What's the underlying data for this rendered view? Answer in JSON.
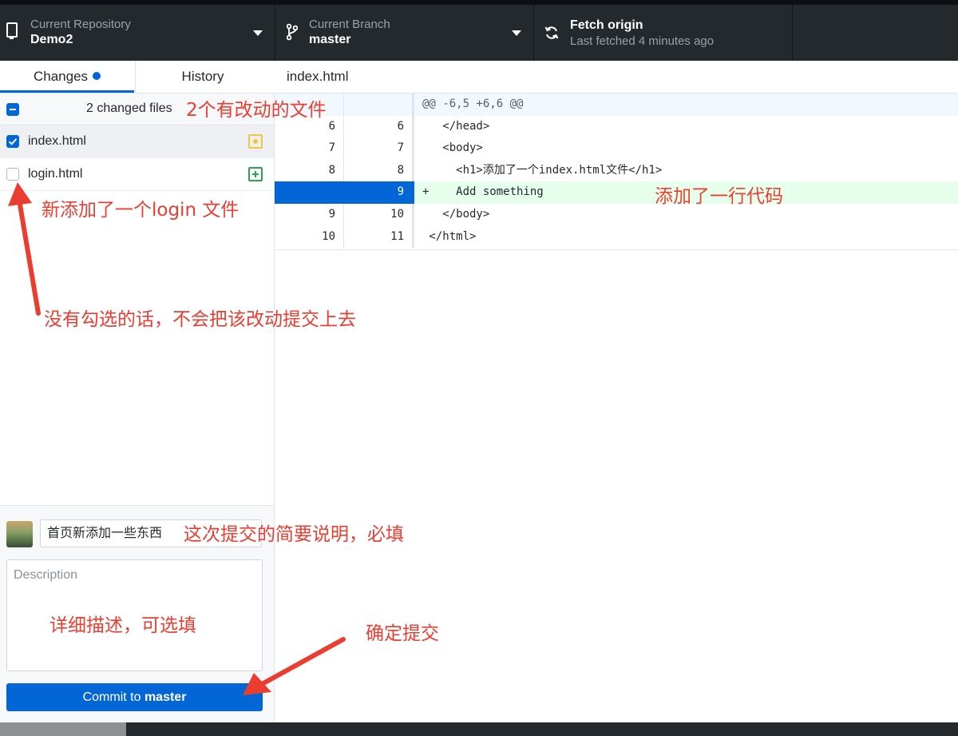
{
  "toolbar": {
    "repo_label": "Current Repository",
    "repo_name": "Demo2",
    "branch_label": "Current Branch",
    "branch_name": "master",
    "fetch_title": "Fetch origin",
    "fetch_subtitle": "Last fetched 4 minutes ago"
  },
  "tabs": {
    "changes": "Changes",
    "history": "History"
  },
  "changes": {
    "header": "2 changed files",
    "files": [
      {
        "name": "index.html",
        "checked": true,
        "status": "modified"
      },
      {
        "name": "login.html",
        "checked": false,
        "status": "added"
      }
    ]
  },
  "commit": {
    "summary": "首页新添加一些东西",
    "description_placeholder": "Description",
    "button_prefix": "Commit to",
    "button_branch": "master"
  },
  "diff": {
    "filename": "index.html",
    "rows": [
      {
        "old": "",
        "new": "",
        "text": "@@ -6,5 +6,6 @@",
        "kind": "hunk"
      },
      {
        "old": "6",
        "new": "6",
        "text": "   </head>",
        "kind": "ctx"
      },
      {
        "old": "7",
        "new": "7",
        "text": "   <body>",
        "kind": "ctx"
      },
      {
        "old": "8",
        "new": "8",
        "text": "     <h1>添加了一个index.html文件</h1>",
        "kind": "ctx"
      },
      {
        "old": "",
        "new": "9",
        "text": "+    Add something",
        "kind": "add"
      },
      {
        "old": "9",
        "new": "10",
        "text": "   </body>",
        "kind": "ctx"
      },
      {
        "old": "10",
        "new": "11",
        "text": " </html>",
        "kind": "ctx"
      }
    ]
  },
  "annotations": {
    "changed_files": "2个有改动的文件",
    "new_file": "新添加了一个login 文件",
    "unchecked": "没有勾选的话，不会把该改动提交上去",
    "added_line": "添加了一行代码",
    "summary_note": "这次提交的简要说明，必填",
    "desc_note": "详细描述，可选填",
    "commit_note": "确定提交"
  },
  "colors": {
    "accent": "#0366d6",
    "annotation": "#ec3d31",
    "added_bg": "#e6ffed",
    "hunk_bg": "#f1f8ff"
  }
}
